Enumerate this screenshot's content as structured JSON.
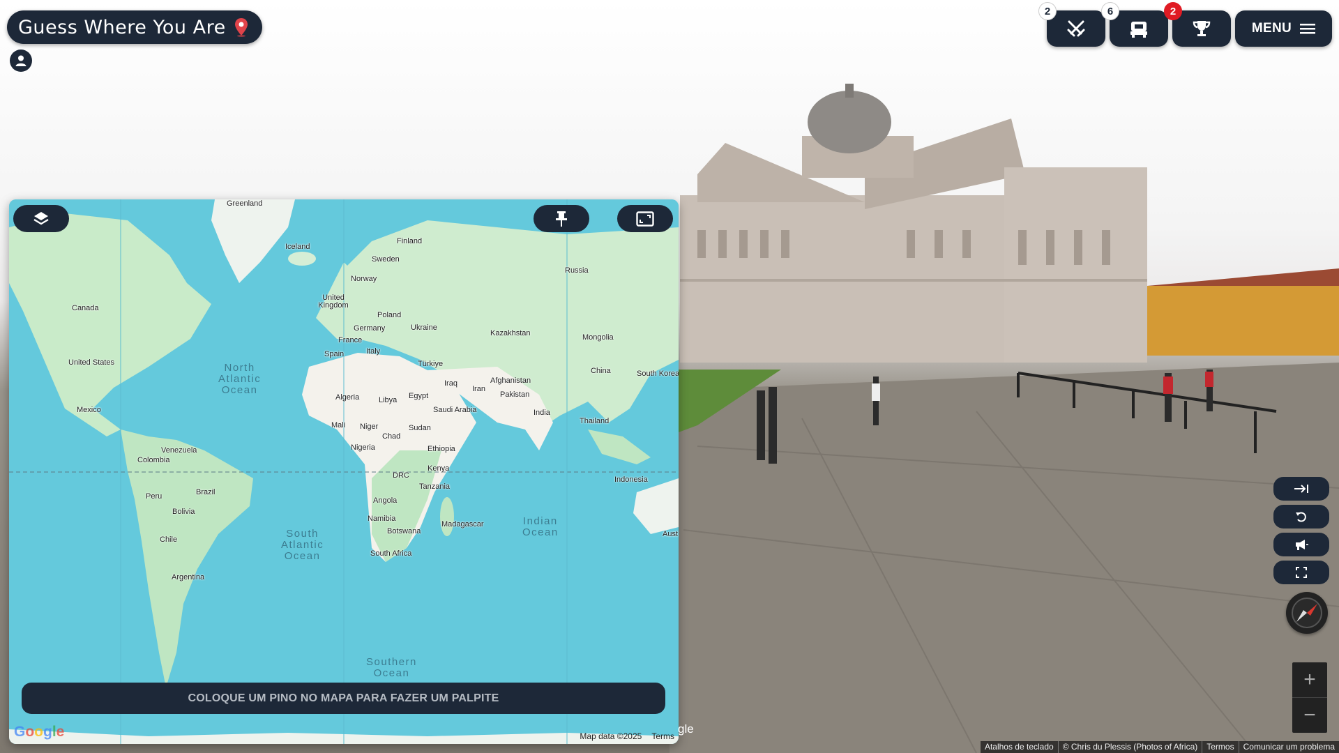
{
  "app": {
    "title": "Guess Where You Are"
  },
  "top_actions": {
    "battle": {
      "badge": "2",
      "icon": "crossed-swords-icon"
    },
    "party": {
      "badge": "6",
      "icon": "ticket-seat-icon"
    },
    "trophy": {
      "badge": "2",
      "icon": "trophy-icon"
    },
    "menu_label": "MENU"
  },
  "map": {
    "guess_prompt": "COLOQUE UM PINO NO MAPA PARA FAZER UM PALPITE",
    "map_data": "Map data ©2025",
    "terms": "Terms",
    "google_logo": "Google",
    "countries": [
      "Greenland",
      "Iceland",
      "Finland",
      "Sweden",
      "Norway",
      "Russia",
      "United Kingdom",
      "Poland",
      "Ukraine",
      "Kazakhstan",
      "Mongolia",
      "Canada",
      "Germany",
      "France",
      "Spain",
      "Italy",
      "Türkiye",
      "China",
      "South Korea",
      "United States",
      "Afghanistan",
      "Iraq",
      "Iran",
      "Pakistan",
      "Algeria",
      "Libya",
      "Egypt",
      "Saudi Arabia",
      "India",
      "Mexico",
      "Mali",
      "Niger",
      "Sudan",
      "Thailand",
      "Chad",
      "Nigeria",
      "Ethiopia",
      "Venezuela",
      "Colombia",
      "Kenya",
      "Indonesia",
      "DRC",
      "Tanzania",
      "Peru",
      "Brazil",
      "Bolivia",
      "Angola",
      "Namibia",
      "Madagascar",
      "Botswana",
      "Chile",
      "South Africa",
      "Argentina",
      "Aust"
    ],
    "oceans": [
      "North\nAtlantic\nOcean",
      "South\nAtlantic\nOcean",
      "Indian\nOcean",
      "Southern\nOcean"
    ]
  },
  "side_controls": [
    "exit-icon",
    "undo-icon",
    "megaphone-icon",
    "fullscreen-icon"
  ],
  "zoom": {
    "plus": "+",
    "minus": "−"
  },
  "streetview": {
    "google_fragment": "gle",
    "footer": [
      "Atalhos de teclado",
      "© Chris du Plessis (Photos of Africa)",
      "Termos",
      "Comunicar um problema"
    ]
  },
  "colors": {
    "panel": "#1d2838",
    "badge_red": "#e01b24",
    "ocean": "#64c9dc",
    "land": "#c9ebc9"
  }
}
